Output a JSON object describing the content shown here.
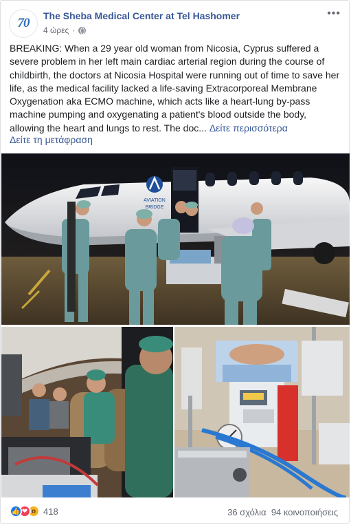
{
  "post": {
    "page_name": "The Sheba Medical Center at Tel Hashomer",
    "avatar_text": "70",
    "timestamp": "4 ώρες",
    "body_text": "BREAKING: When a 29 year old woman from Nicosia, Cyprus suffered a severe problem in her left main cardiac arterial region during the course of childbirth, the doctors at Nicosia Hospital were running out of time to save her life, as the medical facility lacked a life-saving Extracorporeal Membrane Oxygenation aka ECMO machine, which acts like a heart-lung by-pass machine pumping and oxygenating a patient's blood outside the body, allowing the heart and lungs to rest. The doc...",
    "see_more": "Δείτε περισσότερα",
    "see_translation": "Δείτε τη μετάφραση",
    "more_icon": "more-options-icon",
    "privacy_icon": "globe-icon"
  },
  "photos": {
    "plane_logo_text_1": "AVIATION",
    "plane_logo_text_2": "BRIDGE"
  },
  "footer": {
    "reaction_icons": [
      "like-icon",
      "love-icon",
      "wow-icon"
    ],
    "reaction_count": "418",
    "comments": "36 σχόλια",
    "shares": "94 κοινοποιήσεις"
  },
  "colors": {
    "link": "#385898",
    "like": "#1877f2",
    "love": "#f33e58",
    "wow": "#f7b125",
    "scrubs": "#6a9a9c"
  }
}
